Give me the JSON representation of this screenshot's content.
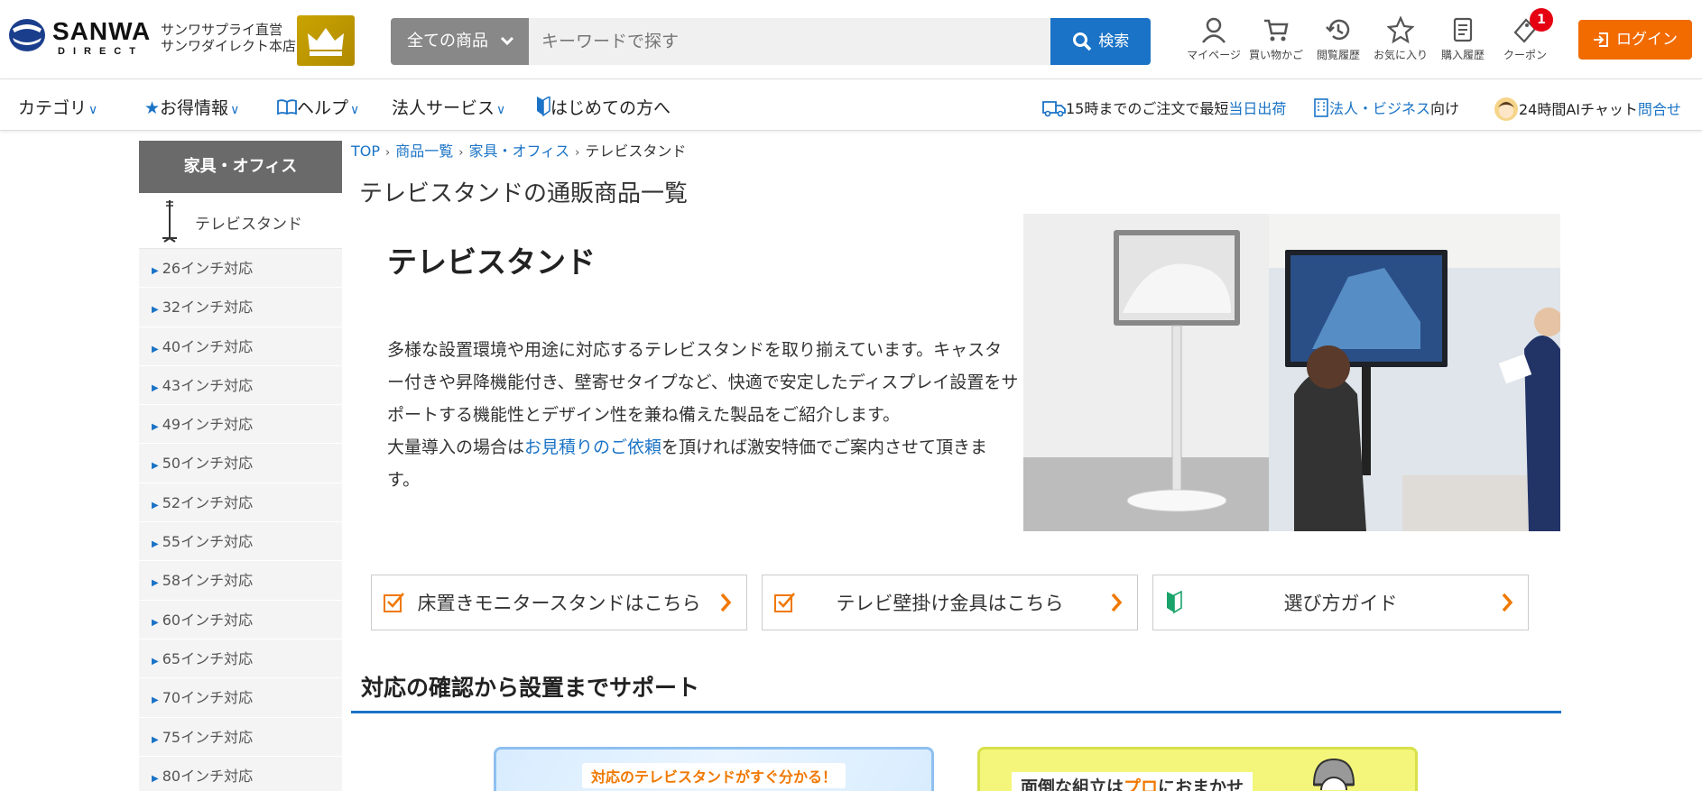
{
  "header": {
    "store_line1": "サンワサプライ直営",
    "store_line2": "サンワダイレクト本店",
    "search_category": "全ての商品",
    "search_placeholder": "キーワードで探す",
    "search_button": "検索",
    "icons": [
      {
        "name": "mypage",
        "label": "マイページ"
      },
      {
        "name": "cart",
        "label": "買い物かご"
      },
      {
        "name": "history",
        "label": "閲覧履歴"
      },
      {
        "name": "favorites",
        "label": "お気に入り"
      },
      {
        "name": "purchase-history",
        "label": "購入履歴"
      },
      {
        "name": "coupon",
        "label": "クーポン",
        "badge": "1"
      }
    ],
    "login": "ログイン"
  },
  "nav": {
    "category": "カテゴリ",
    "deals": "お得情報",
    "help": "ヘルプ",
    "business": "法人サービス",
    "beginners": "はじめての方へ",
    "shipping_text": "15時までのご注文で最短",
    "shipping_link": "当日出荷",
    "corp_link": "法人・ビジネス",
    "corp_suffix": "向け",
    "chat_text": "24時間AIチャット",
    "chat_link": "問合せ"
  },
  "sidebar": {
    "heading": "家具・オフィス",
    "current": "テレビスタンド",
    "items": [
      "26インチ対応",
      "32インチ対応",
      "40インチ対応",
      "43インチ対応",
      "49インチ対応",
      "50インチ対応",
      "52インチ対応",
      "55インチ対応",
      "58インチ対応",
      "60インチ対応",
      "65インチ対応",
      "70インチ対応",
      "75インチ対応",
      "80インチ対応"
    ]
  },
  "breadcrumb": {
    "top": "TOP",
    "list": "商品一覧",
    "cat": "家具・オフィス",
    "current": "テレビスタンド"
  },
  "main": {
    "page_title": "テレビスタンドの通販商品一覧",
    "hero_title": "テレビスタンド",
    "desc_line1": "多様な設置環境や用途に対応するテレビスタンドを取り揃えています。キャスター付きや昇降機能付き、壁寄せタイプなど、快適で安定したディスプレイ設置をサポートする機能性とデザイン性を兼ね備えた製品をご紹介します。",
    "desc_pre": "大量導入の場合は",
    "desc_link": "お見積りのご依頼",
    "desc_post": "を頂ければ激安特価でご案内させて頂きます。",
    "guide_buttons": [
      "床置きモニタースタンドはこちら",
      "テレビ壁掛け金具はこちら",
      "選び方ガイド"
    ],
    "section_title": "対応の確認から設置までサポート",
    "banner1_tag": "対応のテレビスタンドがすぐ分かる！",
    "banner2_pre": "面倒な組立は",
    "banner2_accent": "プロ",
    "banner2_post": "におまかせ"
  },
  "colors": {
    "primary": "#1a73c6",
    "login": "#f26b00",
    "badge": "#e50012",
    "sidebar_head": "#6a6a6a"
  }
}
